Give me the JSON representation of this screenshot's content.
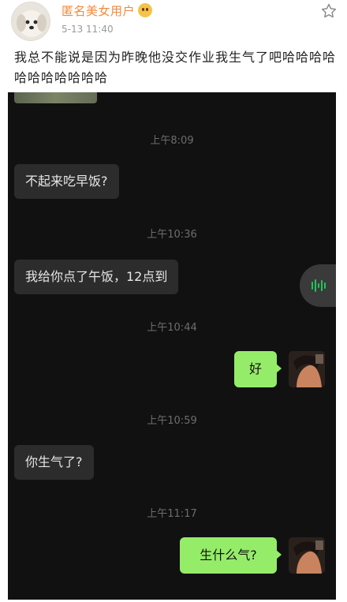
{
  "post": {
    "username": "匿名美女用户",
    "date": "5-13 11:40",
    "text": "我总不能说是因为昨晚他没交作业我生气了吧哈哈哈哈哈哈哈哈哈哈哈"
  },
  "chat": {
    "messages": [
      {
        "time": "上午8:09",
        "text": "不起来吃早饭?",
        "side": "left"
      },
      {
        "time": "上午10:36",
        "text": "我给你点了午饭，12点到",
        "side": "left"
      },
      {
        "time": "上午10:44",
        "text": "好",
        "side": "right"
      },
      {
        "time": "上午10:59",
        "text": "你生气了?",
        "side": "left"
      },
      {
        "time": "上午11:17",
        "text": "生什么气?",
        "side": "right"
      }
    ]
  },
  "colors": {
    "username": "#f08a3c",
    "chat_background": "#111111",
    "incoming_bubble": "#2c2c2c",
    "outgoing_bubble": "#95ec69",
    "voice_accent": "#22c55e"
  },
  "icons": [
    "star-icon",
    "voice-icon",
    "verified-emoji-icon"
  ]
}
